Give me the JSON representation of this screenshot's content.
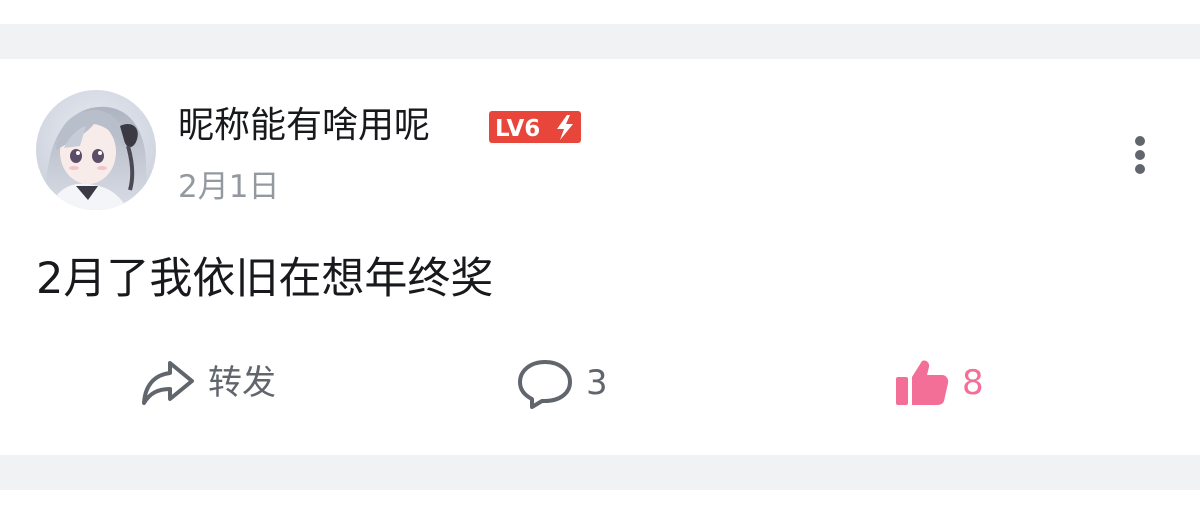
{
  "post": {
    "username": "昵称能有啥用呢",
    "level_badge": "LV6",
    "date": "2月1日",
    "content": "2月了我依旧在想年终奖"
  },
  "actions": {
    "forward_label": "转发",
    "comment_count": "3",
    "like_count": "8"
  },
  "icons": {
    "forward": "share-arrow-icon",
    "comment": "speech-bubble-icon",
    "like": "thumbs-up-icon",
    "more": "vertical-dots-icon"
  },
  "colors": {
    "level_badge_bg": "#e8463b",
    "like_accent": "#f36f98",
    "text_primary": "#18191c",
    "text_secondary": "#9499a0",
    "icon_gray": "#61666d",
    "divider_bg": "#f1f2f3"
  }
}
